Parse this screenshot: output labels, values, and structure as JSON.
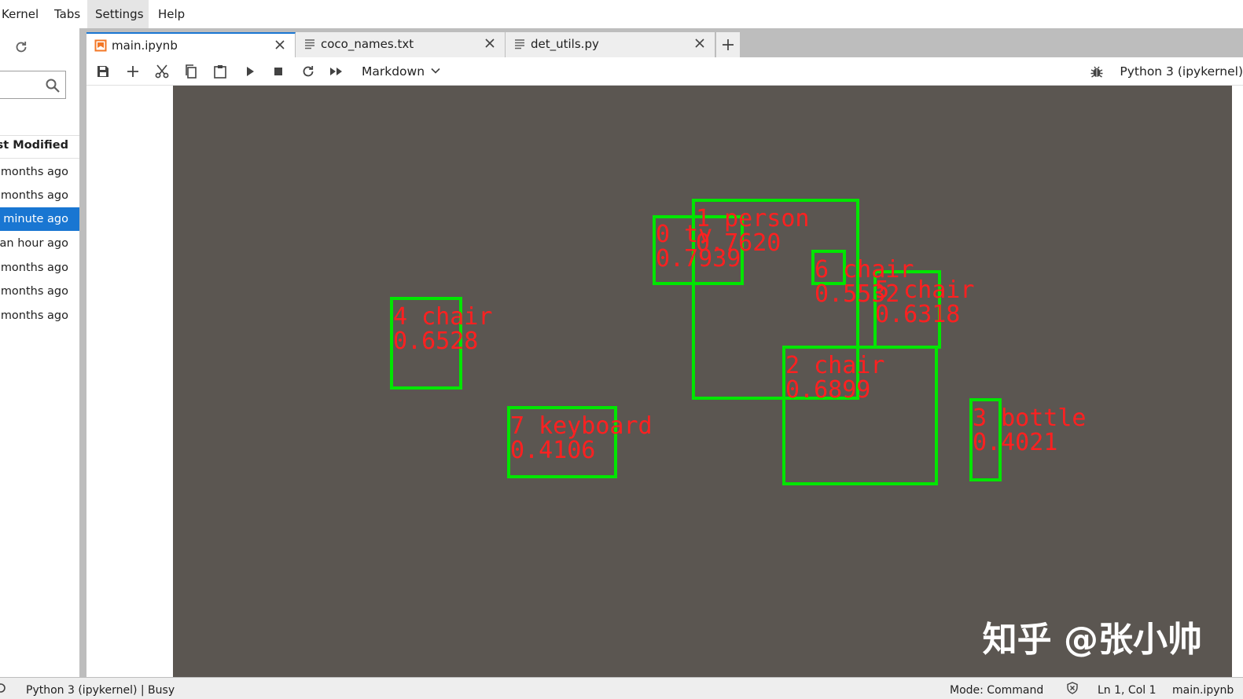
{
  "menubar": {
    "items": [
      {
        "label": "Kernel"
      },
      {
        "label": "Tabs"
      },
      {
        "label": "Settings",
        "active": true
      },
      {
        "label": "Help"
      }
    ]
  },
  "filebrowser": {
    "header": "ast Modified",
    "rows": [
      {
        "modified": "months ago",
        "selected": false
      },
      {
        "modified": "months ago",
        "selected": false
      },
      {
        "modified": "minute ago",
        "selected": true
      },
      {
        "modified": "an hour ago",
        "selected": false
      },
      {
        "modified": "months ago",
        "selected": false
      },
      {
        "modified": "months ago",
        "selected": false
      },
      {
        "modified": "months ago",
        "selected": false
      }
    ]
  },
  "tabs": [
    {
      "label": "main.ipynb",
      "icon": "notebook-icon",
      "active": true
    },
    {
      "label": "coco_names.txt",
      "icon": "text-file-icon",
      "active": false
    },
    {
      "label": "det_utils.py",
      "icon": "text-file-icon",
      "active": false
    }
  ],
  "toolbar": {
    "cell_type": "Markdown",
    "kernel": "Python 3 (ipykernel)"
  },
  "output": {
    "detections": [
      {
        "label": "0 tv",
        "score": "0.7939"
      },
      {
        "label": "1 person",
        "score": "0.7620"
      },
      {
        "label": "6 chair",
        "score": "0.5532"
      },
      {
        "label": "5 chair",
        "score": "0.6318"
      },
      {
        "label": "4 chair",
        "score": "0.6528"
      },
      {
        "label": "2 chair",
        "score": "0.6899"
      },
      {
        "label": "7 keyboard",
        "score": "0.4106"
      },
      {
        "label": "3 bottle",
        "score": "0.4021"
      }
    ],
    "watermark": "知乎 @张小帅"
  },
  "statusbar": {
    "kernel_status": "Python 3 (ipykernel) | Busy",
    "mode": "Mode: Command",
    "position": "Ln 1, Col 1",
    "filename": "main.ipynb"
  },
  "colors": {
    "accent": "#1976d2",
    "box": "#00e600",
    "label": "#ff2020"
  }
}
